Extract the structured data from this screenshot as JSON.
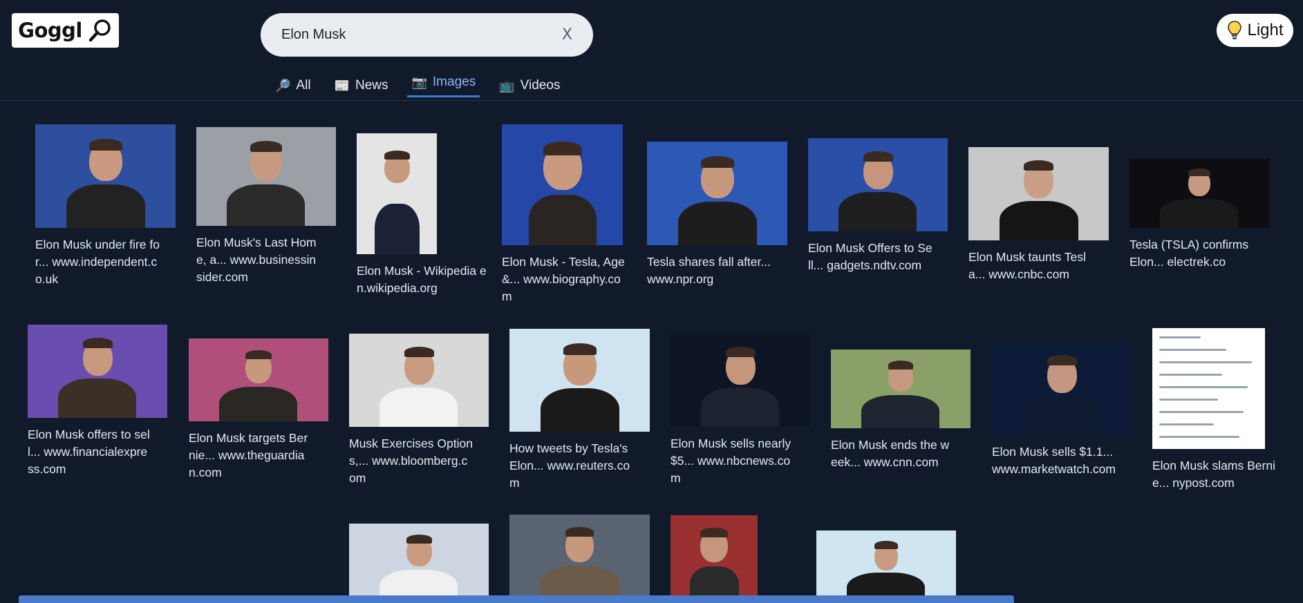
{
  "logo": {
    "text": "Goggl"
  },
  "search": {
    "value": "Elon Musk",
    "clear_label": "X"
  },
  "theme": {
    "label": "Light"
  },
  "tabs": [
    {
      "label": "All",
      "icon": "🔎"
    },
    {
      "label": "News",
      "icon": "📰"
    },
    {
      "label": "Images",
      "icon": "📷"
    },
    {
      "label": "Videos",
      "icon": "📺"
    }
  ],
  "results": [
    {
      "title": "Elon Musk under fire for...",
      "source": "www.independent.co.uk"
    },
    {
      "title": "Elon Musk's Last Home, a...",
      "source": "www.businessinsider.com"
    },
    {
      "title": "Elon Musk - Wikipedia",
      "source": "en.wikipedia.org"
    },
    {
      "title": "Elon Musk - Tesla, Age &...",
      "source": "www.biography.com"
    },
    {
      "title": "Tesla shares fall after...",
      "source": "www.npr.org"
    },
    {
      "title": "Elon Musk Offers to Sell...",
      "source": "gadgets.ndtv.com"
    },
    {
      "title": "Elon Musk taunts Tesla...",
      "source": "www.cnbc.com"
    },
    {
      "title": "Tesla (TSLA) confirms Elon...",
      "source": "electrek.co"
    },
    {
      "title": "Elon Musk offers to sell...",
      "source": "www.financialexpress.com"
    },
    {
      "title": "Elon Musk targets Bernie...",
      "source": "www.theguardian.com"
    },
    {
      "title": "Musk Exercises Options,...",
      "source": "www.bloomberg.com"
    },
    {
      "title": "How tweets by Tesla's Elon...",
      "source": "www.reuters.com"
    },
    {
      "title": "Elon Musk sells nearly $5...",
      "source": "www.nbcnews.com"
    },
    {
      "title": "Elon Musk ends the week...",
      "source": "www.cnn.com"
    },
    {
      "title": "Elon Musk sells $1.1...",
      "source": "www.marketwatch.com"
    },
    {
      "title": "Elon Musk slams Bernie...",
      "source": "nypost.com"
    },
    {
      "title": "",
      "source": ""
    },
    {
      "title": "",
      "source": ""
    },
    {
      "title": "",
      "source": ""
    },
    {
      "title": "",
      "source": ""
    }
  ]
}
